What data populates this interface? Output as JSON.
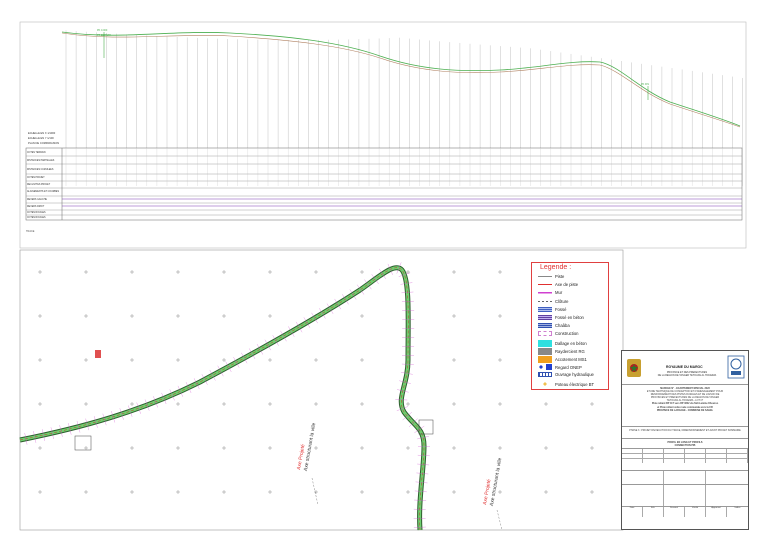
{
  "profile": {
    "scale_lines": [
      "ECHELLE EN X 1/1000",
      "ECHELLE EN Y 1/100",
      "PLAN DE COMPARAISON"
    ],
    "rows": [
      "COTES TERRAIN",
      "DISTANCES PARTIELLES",
      "DISTANCES CUMULEES",
      "COTES PROJET",
      "DECLIVITES PROJET",
      "ALIGNEMENTS ET COURBES",
      "DEVERS GAUCHE",
      "DEVERS DROIT",
      "COTES ROUGES",
      "COTES ROUGES"
    ],
    "section_label": "TRACE"
  },
  "legend": {
    "title": "Legende :",
    "items": [
      {
        "label": "Piste",
        "symbol": "line-gray"
      },
      {
        "label": "Axe de piste",
        "symbol": "line-red"
      },
      {
        "label": "Mur",
        "symbol": "line-magenta"
      },
      {
        "label": "Clôture",
        "symbol": "line-dash"
      },
      {
        "label": "Fossé",
        "symbol": "hatch-blue"
      },
      {
        "label": "Fossé en béton",
        "symbol": "hatch-blue2"
      },
      {
        "label": "Chaâba",
        "symbol": "hatch-blue3"
      },
      {
        "label": "Construction",
        "symbol": "box-pink"
      },
      {
        "label": "Dallage en béton",
        "symbol": "fill-cyan"
      },
      {
        "label": "Raydercient RG",
        "symbol": "fill-gray"
      },
      {
        "label": "Accotement MS1",
        "symbol": "fill-orange"
      },
      {
        "label": "Regard ONEP",
        "symbol": "regard"
      },
      {
        "label": "Ouvrage hydraulique",
        "symbol": "ouvrage"
      },
      {
        "label": "Poteau électrique BT",
        "symbol": "poteau"
      }
    ]
  },
  "plan": {
    "road_label_1": [
      "Axe Projeté",
      "Axe structurant la ville"
    ],
    "road_label_2": [
      "Axe Projeté",
      "Axe structurant la ville"
    ]
  },
  "title_block": {
    "royaume": "ROYAUME DU MAROC",
    "header_lines": [
      "PROVINCE ET DES PREFECTURES",
      "DE LA REGION DE TANGER TETOUAN AL HOCEIMA"
    ],
    "project_lines": [
      "MARCHE N° - ECARTEMENT-SPECIAL 2023",
      "ETUDE TECHNIQUE DE CONCEPTION ET D'AMENAGEMENT POUR",
      "RENFORCEMENT DES PISTES RURALES ET DE LIAISON DE",
      "PROVINCES ET PREFECTURES DE LA REGION DE TANGER",
      "TETOUAN AL HOCEIMA - LOT N°",
      "Piste reliant RP 417 vers RP 4602 via Sidi Lamine Khouroo",
      "et Piste reliant cette route communale vers la CR",
      "PROVINCE DE LARACHE - COMMUNE DE SAHEL"
    ],
    "subject": "PHASE 3 : PROJET D'EXECUTION DU TRACE, DIMENSIONNEMENT ET AVANT PROJET SOMMAIRE",
    "drawing_title": [
      "PROFIL EN LONG ET PROFILS",
      "CONNECTION PIB"
    ],
    "footer_cols": [
      "Date",
      "Ech",
      "Dessiné",
      "Vérifié",
      "Approuvé",
      "Indice"
    ]
  }
}
